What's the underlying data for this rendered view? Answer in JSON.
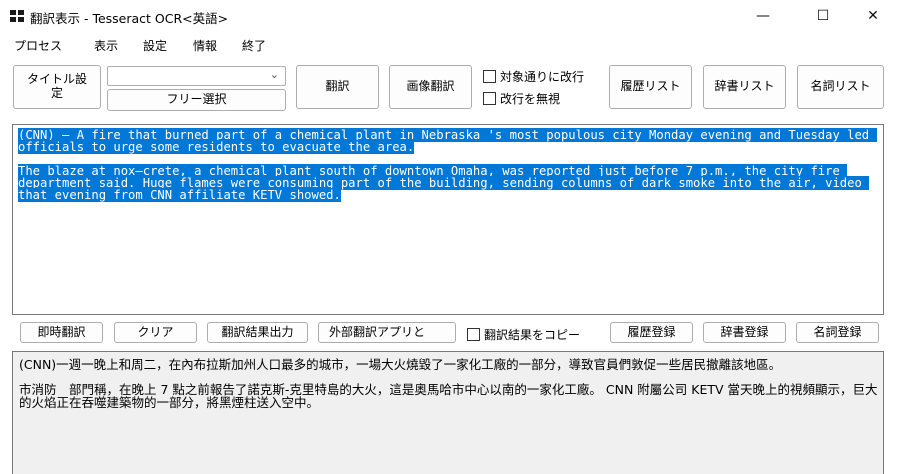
{
  "window": {
    "title": "翻訳表示 - Tesseract OCR<英語>",
    "minimize_glyph": "—",
    "maximize_glyph": "☐",
    "close_glyph": "✕"
  },
  "menu": [
    "プロセス",
    "表示",
    "設定",
    "情報",
    "終了"
  ],
  "toolbar": {
    "title_settings": "タイトル設定",
    "combo_value": "",
    "free_select": "フリー選択",
    "translate": "翻訳",
    "image_translate": "画像翻訳",
    "newline_as_source": "対象通りに改行",
    "ignore_newline": "改行を無視",
    "history_list": "履歴リスト",
    "dictionary_list": "辞書リスト",
    "noun_list": "名詞リスト"
  },
  "source_text": {
    "paragraph1": "(CNN) — A fire that burned part of a chemical plant in Nebraska 's most populous city Monday evening and Tuesday led officials to urge some residents to evacuate the area.",
    "paragraph2": "The blaze at nox—crete, a chemical plant south of downtown Omaha, was reported just before 7 p.m., the city fire department said. Huge flames were consuming part of the building, sending columns of dark smoke into the air, video that evening from CNN affiliate KETV showed."
  },
  "bottom_bar": {
    "instant_translate": "即時翻訳",
    "clear": "クリア",
    "output_result": "翻訳結果出力",
    "external_app": "外部翻訳アプリと",
    "copy_result": "翻訳結果をコピー",
    "register_history": "履歴登録",
    "register_dictionary": "辞書登録",
    "register_noun": "名詞登録"
  },
  "output_text": {
    "paragraph1": "(CNN)一週一晚上和周二，在內布拉斯加州人口最多的城市，一場大火燒毀了一家化工廠的一部分，導致官員們敦促一些居民撤離該地區。",
    "paragraph2": "市消防　部門稱，在晚上 7 點之前報告了諾克斯-克里特島的大火，這是奧馬哈市中心以南的一家化工廠。 CNN 附屬公司 KETV 當天晚上的視頻顯示，巨大的火焰正在吞噬建築物的一部分，將黑煙柱送入空中。"
  },
  "colors": {
    "selection": "#0078d7",
    "output_background": "#f0f0f0"
  }
}
